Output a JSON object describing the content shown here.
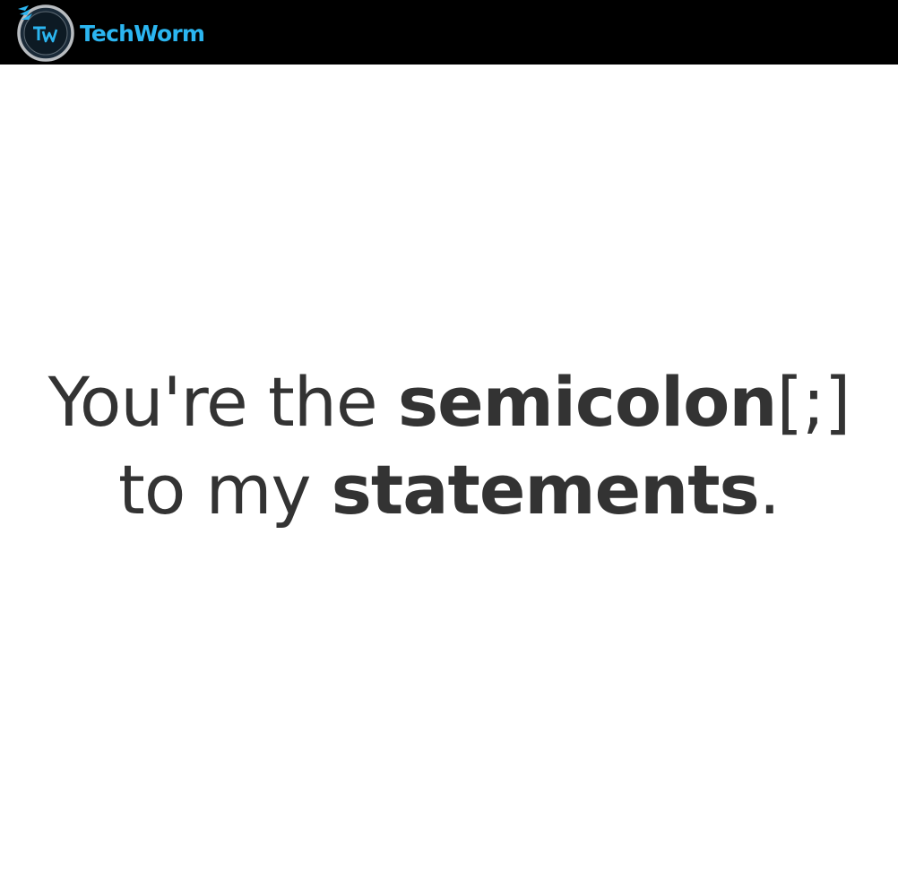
{
  "brand": {
    "name": "TechWorm",
    "monogram": "TW",
    "colors": {
      "bar": "#000000",
      "accent": "#2bb5f0",
      "ring": "#b8bcc0",
      "badge": "#1a2a38"
    }
  },
  "quote": {
    "line1": {
      "lead": "You're the ",
      "emphasis": "semicolon",
      "tail": "[;]"
    },
    "line2": {
      "lead": "to my ",
      "emphasis": "statements",
      "tail": "."
    },
    "color": "#333333"
  }
}
